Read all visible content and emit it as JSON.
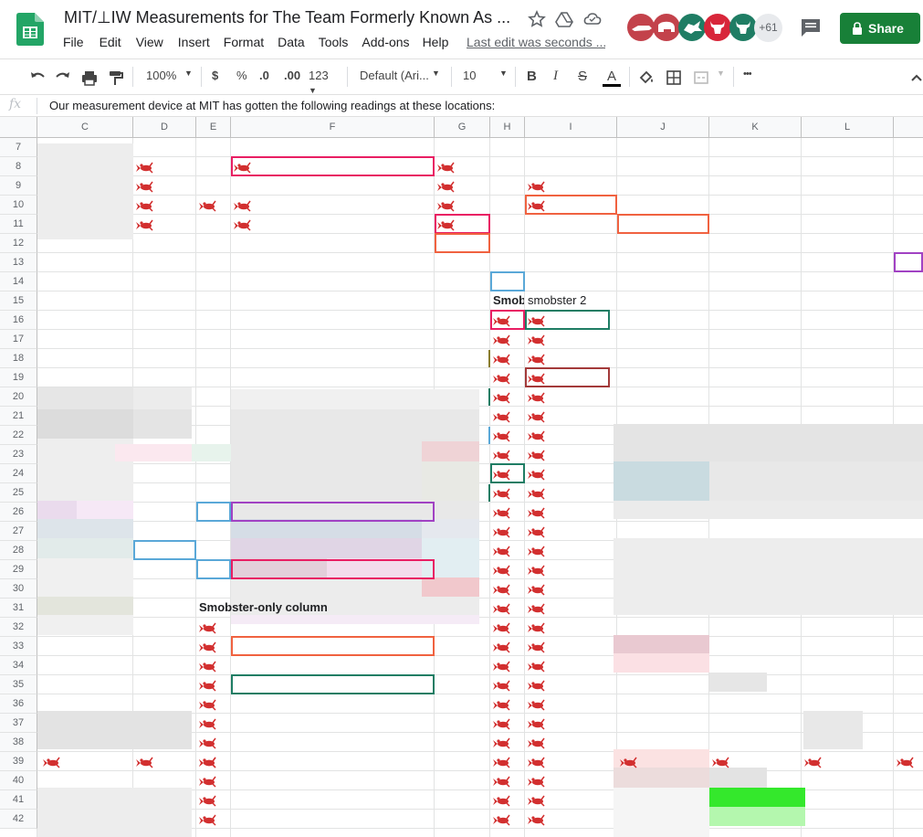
{
  "doc": {
    "title": "MIT/⊥IW Measurements for  The Team Formerly Known As ...",
    "last_edit": "Last edit was seconds ..."
  },
  "menu": [
    "File",
    "Edit",
    "View",
    "Insert",
    "Format",
    "Data",
    "Tools",
    "Add-ons",
    "Help"
  ],
  "collaborators": {
    "more": "+61"
  },
  "share": {
    "label": "Share"
  },
  "toolbar": {
    "zoom": "100%",
    "currency": "$",
    "percent": "%",
    "dec_less": ".0",
    "dec_more": ".00",
    "format": "123",
    "font": "Default (Ari...",
    "size": "10",
    "bold": "B",
    "italic": "I",
    "strike": "S",
    "text_color": "A",
    "more": "•••"
  },
  "formula": {
    "fx": "fx",
    "text": "Our measurement device at MIT has gotten the following readings at these locations:"
  },
  "columns": [
    "C",
    "D",
    "E",
    "F",
    "G",
    "H",
    "I",
    "J",
    "K",
    "L"
  ],
  "rows": [
    "7",
    "8",
    "9",
    "10",
    "11",
    "12",
    "13",
    "14",
    "15",
    "16",
    "17",
    "18",
    "19",
    "20",
    "21",
    "22",
    "23",
    "24",
    "25",
    "26",
    "27",
    "28",
    "29",
    "30",
    "31",
    "32",
    "33",
    "34",
    "35",
    "36",
    "37",
    "38",
    "39",
    "40",
    "41",
    "42"
  ],
  "cells": {
    "smob_truncated": "Smob",
    "smobster2": "smobster 2",
    "smobster_only": "Smobster-only column"
  },
  "icons": {
    "cell_icon": "lobster-icon"
  },
  "colors": {
    "share": "#188038",
    "header_bg": "#f8f9fa",
    "pink": "#e91e63",
    "orange": "#f06240",
    "teal": "#1f7d64",
    "purple": "#a142c3",
    "blue": "#5aa8d8",
    "bright_green": "#34e82c"
  }
}
